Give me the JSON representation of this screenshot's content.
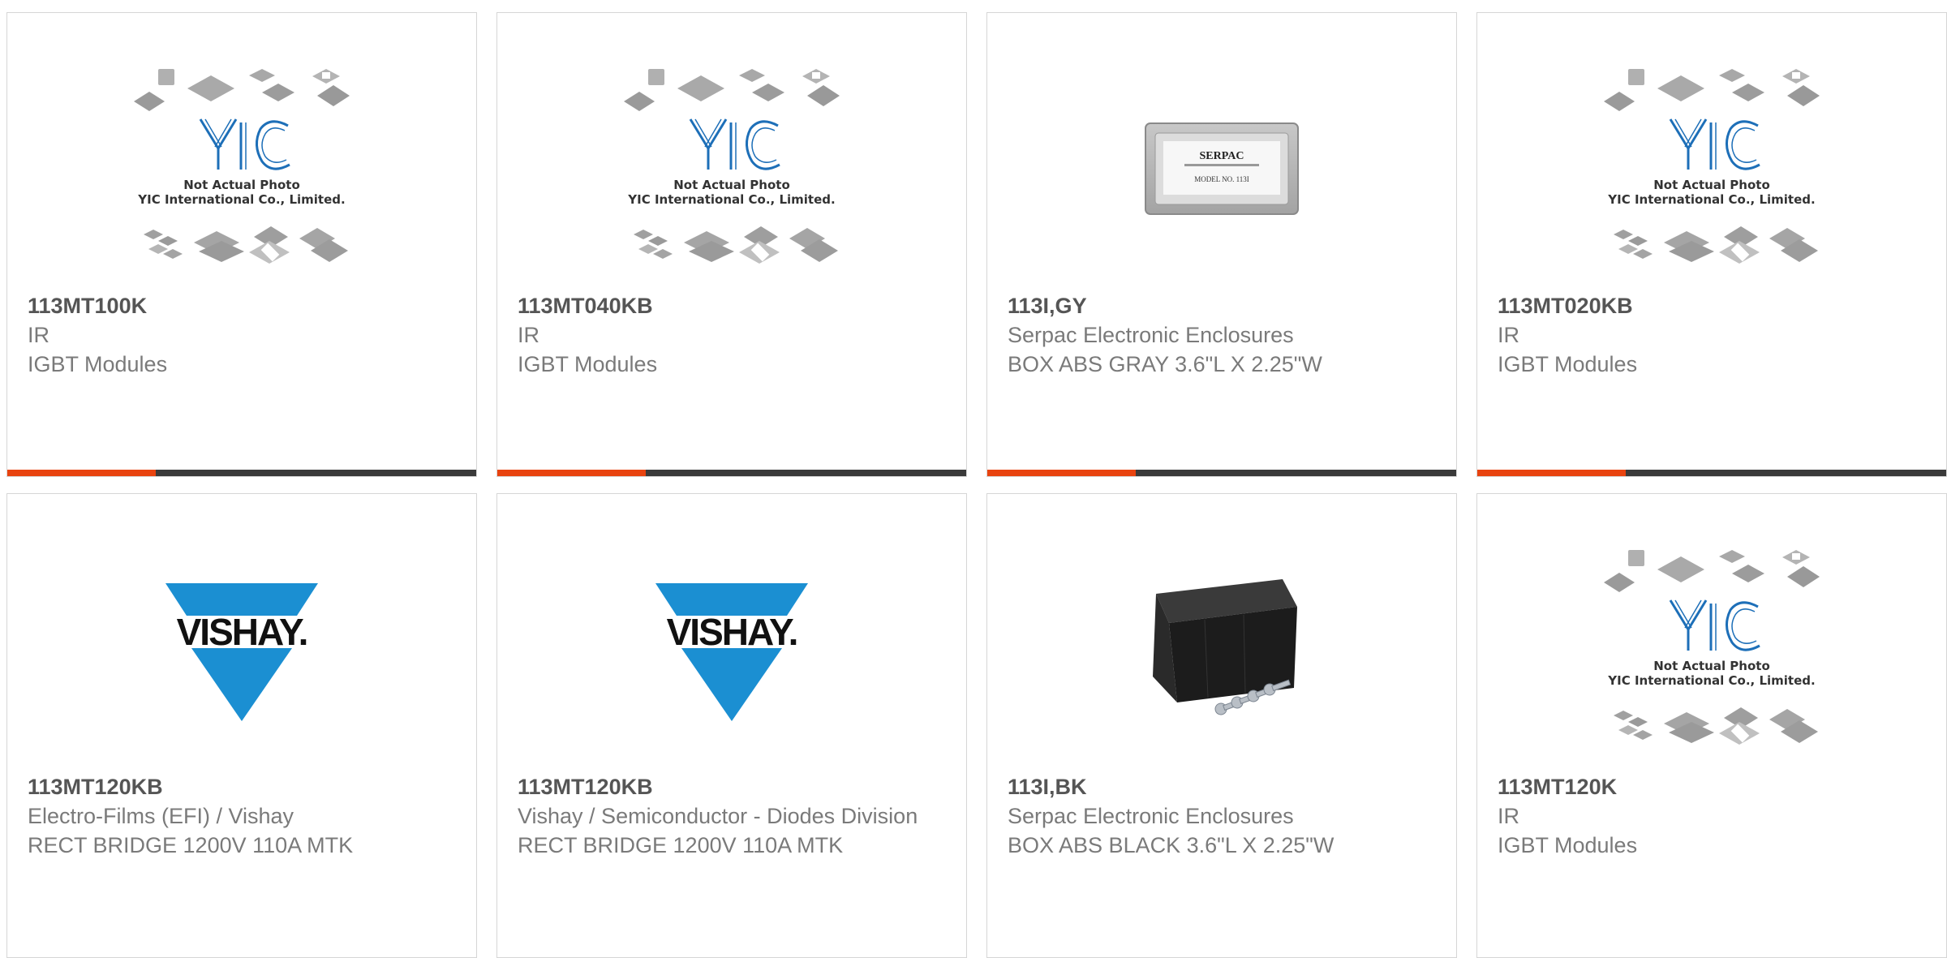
{
  "colors": {
    "accent": "#e8430f",
    "bar_dark": "#3a3a3a",
    "vishay_blue": "#1b8fd2",
    "yic_blue": "#1d6fb8"
  },
  "placeholder": {
    "brand": "YIC",
    "line1": "Not Actual Photo",
    "line2": "YIC International Co., Limited."
  },
  "serpac_label": {
    "brand": "SERPAC",
    "model": "MODEL NO. 113I"
  },
  "vishay_logo_text": "VISHAY.",
  "products": [
    {
      "part_number": "113MT100K",
      "manufacturer": "IR",
      "description": "IGBT Modules",
      "image": "yic-placeholder"
    },
    {
      "part_number": "113MT040KB",
      "manufacturer": "IR",
      "description": "IGBT Modules",
      "image": "yic-placeholder"
    },
    {
      "part_number": "113I,GY",
      "manufacturer": "Serpac Electronic Enclosures",
      "description": "BOX ABS GRAY 3.6\"L X 2.25\"W",
      "image": "gray-enclosure"
    },
    {
      "part_number": "113MT020KB",
      "manufacturer": "IR",
      "description": "IGBT Modules",
      "image": "yic-placeholder"
    },
    {
      "part_number": "113MT120KB",
      "manufacturer": "Electro-Films (EFI) / Vishay",
      "description": "RECT BRIDGE 1200V 110A MTK",
      "image": "vishay-logo"
    },
    {
      "part_number": "113MT120KB",
      "manufacturer": "Vishay / Semiconductor - Diodes Division",
      "description": "RECT BRIDGE 1200V 110A MTK",
      "image": "vishay-logo"
    },
    {
      "part_number": "113I,BK",
      "manufacturer": "Serpac Electronic Enclosures",
      "description": "BOX ABS BLACK 3.6\"L X 2.25\"W",
      "image": "black-enclosure"
    },
    {
      "part_number": "113MT120K",
      "manufacturer": "IR",
      "description": "IGBT Modules",
      "image": "yic-placeholder"
    }
  ]
}
